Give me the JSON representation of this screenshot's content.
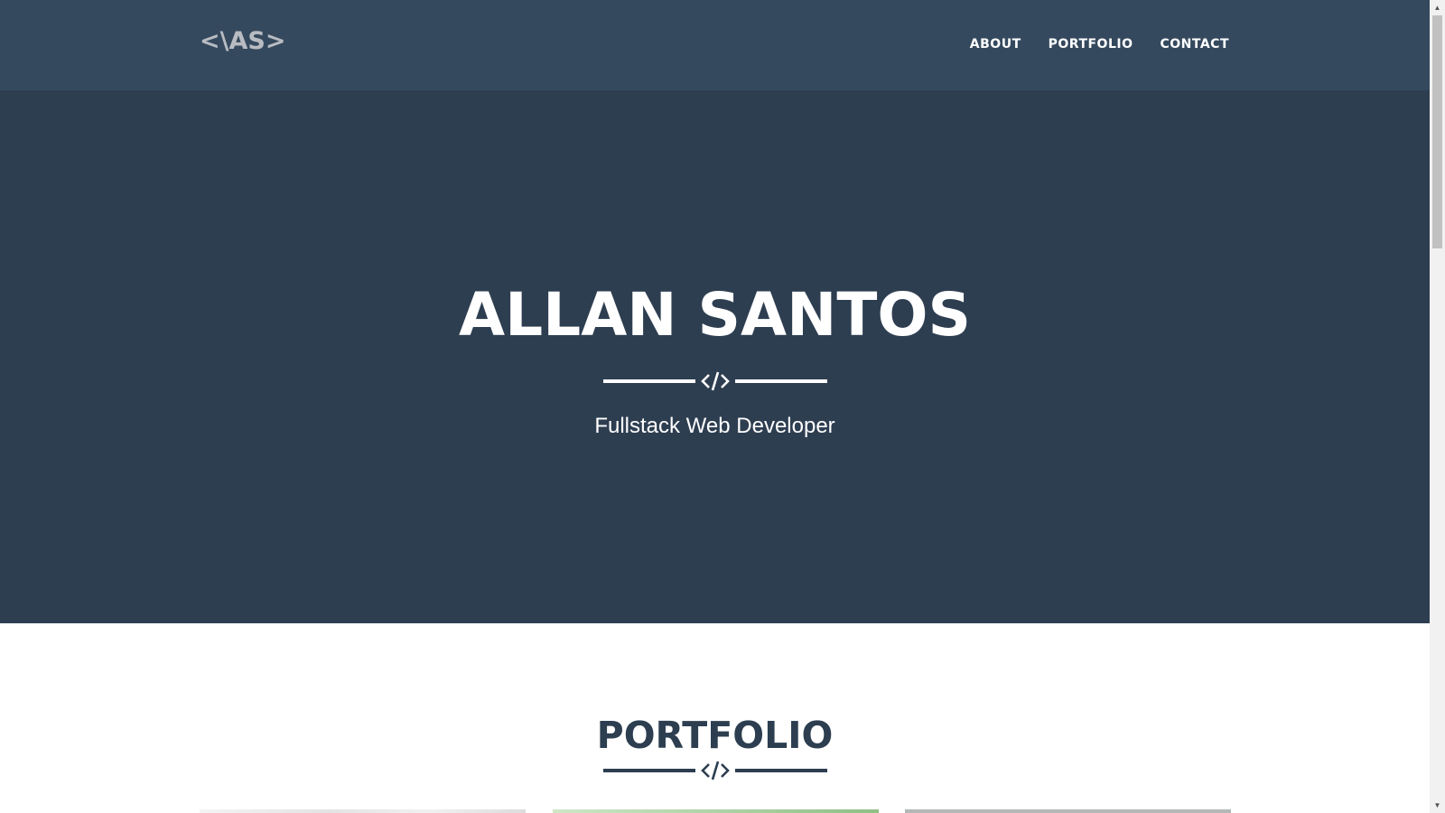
{
  "nav": {
    "brand": "<\\AS>",
    "links": [
      "ABOUT",
      "PORTFOLIO",
      "CONTACT"
    ]
  },
  "hero": {
    "title": "ALLAN SANTOS",
    "divider_icon": "code-icon",
    "subtitle": "Fullstack Web Developer"
  },
  "portfolio": {
    "title": "PORTFOLIO",
    "divider_icon": "code-icon"
  },
  "colors": {
    "navbar_bg": "#35495e",
    "hero_bg": "#2e3e51",
    "text_light": "#ffffff",
    "heading_dark": "#2c3e50"
  },
  "scrollbar": {
    "up_icon": "scroll-up-arrow-icon",
    "down_icon": "scroll-down-arrow-icon"
  }
}
